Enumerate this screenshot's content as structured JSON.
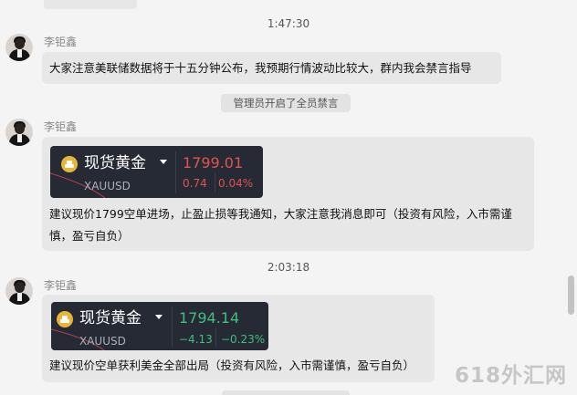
{
  "timestamps": [
    "1:47:30",
    "2:03:18"
  ],
  "system_notice": "管理员开启了全员禁言",
  "messages": [
    {
      "sender": "李钜鑫",
      "text": "大家注意美联储数据将于十五分钟公布，我预期行情波动比较大，群内我会禁言指导"
    },
    {
      "sender": "李钜鑫",
      "card": {
        "name": "现货黄金",
        "symbol": "XAUUSD",
        "price": "1799.01",
        "change": "0.74",
        "change_pct": "0.04%",
        "color": "#e0534f"
      },
      "text_line1": "建议现价1799空单进场，止盈止损等我通知，大家注意我消息即可（投资有风险，入市需谨",
      "text_line2": "慎，盈亏自负）"
    },
    {
      "sender": "李钜鑫",
      "card": {
        "name": "现货黄金",
        "symbol": "XAUUSD",
        "price": "1794.14",
        "change": "−4.13",
        "change_pct": "−0.23%",
        "color": "#3fbf7f"
      },
      "text": "建议现价空单获利美金全部出局（投资有风险，入市需谨慎，盈亏自负）"
    }
  ],
  "watermark": "618外汇网",
  "colors": {
    "background": "#f4f4f4",
    "bubble": "#e7e7e7",
    "card": "#262a35",
    "gold": "#e9b539"
  }
}
